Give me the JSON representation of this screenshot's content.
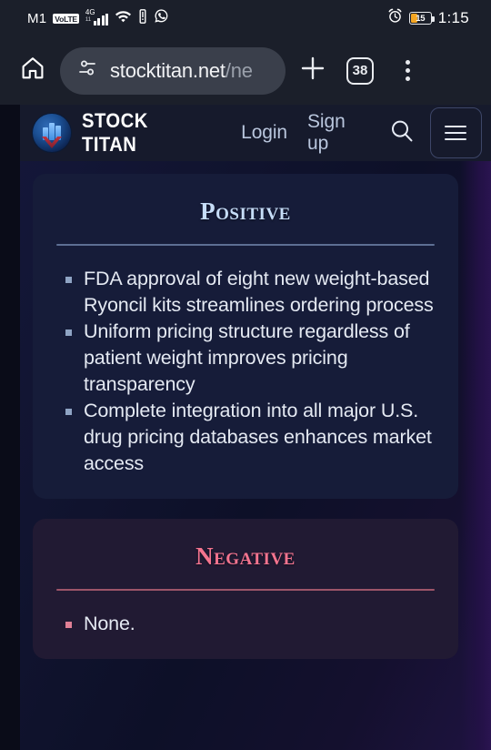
{
  "status_bar": {
    "carrier": "M1",
    "volte_badge": "VoLTE",
    "network_type": "4G",
    "network_sub": "11",
    "signal_icon": "signal-bars-icon",
    "wifi_icon": "wifi-icon",
    "vibrate_icon": "vibrate-icon",
    "whatsapp_icon": "whatsapp-icon",
    "alarm_icon": "alarm-clock-icon",
    "battery_level": "15",
    "battery_color": "#f5a623",
    "time": "1:15"
  },
  "browser": {
    "home_icon": "home-icon",
    "site_settings_icon": "tune-sliders-icon",
    "url_main": "stocktitan.net",
    "url_dim": "/ne",
    "new_tab_icon": "plus-icon",
    "tab_count": "38",
    "tab_switcher_icon": "tab-switcher-icon",
    "menu_icon": "three-dots-vertical-icon"
  },
  "site_header": {
    "logo_icon": "stock-titan-logo-icon",
    "brand": "STOCK TITAN",
    "login_label": "Login",
    "signup_label": "Sign up",
    "search_icon": "search-icon",
    "hamburger_icon": "hamburger-menu-icon"
  },
  "content": {
    "positive": {
      "title": "Positive",
      "accent": "#c6ddf8",
      "items": [
        "FDA approval of eight new weight-based Ryoncil kits streamlines ordering process",
        "Uniform pricing structure regardless of patient weight improves pricing transparency",
        "Complete integration into all major U.S. drug pricing databases enhances market access"
      ]
    },
    "negative": {
      "title": "Negative",
      "accent": "#f4748f",
      "items": [
        "None."
      ]
    }
  }
}
